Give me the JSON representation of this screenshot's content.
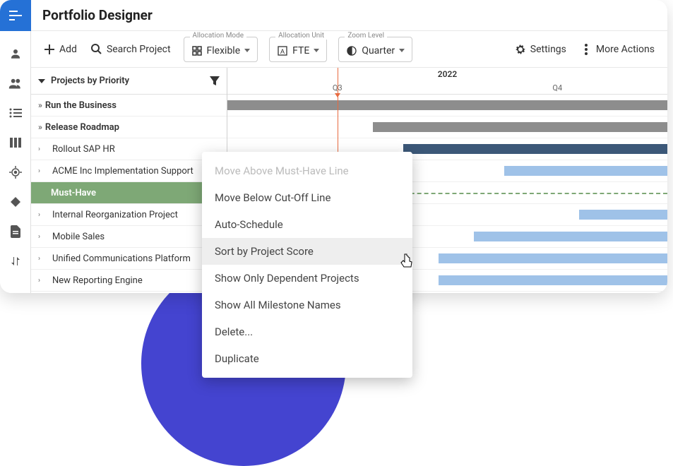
{
  "app_title": "Portfolio Designer",
  "toolbar": {
    "add": "Add",
    "search": "Search Project",
    "allocation_mode": {
      "label": "Allocation Mode",
      "value": "Flexible"
    },
    "allocation_unit": {
      "label": "Allocation Unit",
      "value": "FTE"
    },
    "zoom_level": {
      "label": "Zoom Level",
      "value": "Quarter"
    },
    "settings": "Settings",
    "more": "More Actions"
  },
  "sidebar": {
    "header": "Projects by Priority",
    "items": [
      {
        "label": "Run the Business",
        "type": "group"
      },
      {
        "label": "Release Roadmap",
        "type": "group"
      },
      {
        "label": "Rollout SAP HR",
        "type": "item"
      },
      {
        "label": "ACME Inc Implementation Support",
        "type": "item"
      },
      {
        "label": "Must-Have",
        "type": "musthave"
      },
      {
        "label": "Internal Reorganization Project",
        "type": "item"
      },
      {
        "label": "Mobile Sales",
        "type": "item"
      },
      {
        "label": "Unified Communications Platform",
        "type": "item"
      },
      {
        "label": "New Reporting Engine",
        "type": "item"
      }
    ]
  },
  "gantt": {
    "year": "2022",
    "quarters": [
      "Q3",
      "Q4"
    ]
  },
  "context_menu": {
    "items": [
      {
        "label": "Move Above Must-Have Line",
        "disabled": true
      },
      {
        "label": "Move Below Cut-Off Line",
        "disabled": false
      },
      {
        "label": "Auto-Schedule",
        "disabled": false
      },
      {
        "label": "Sort by Project Score",
        "disabled": false,
        "hover": true
      },
      {
        "label": "Show Only Dependent Projects",
        "disabled": false
      },
      {
        "label": "Show All Milestone Names",
        "disabled": false
      },
      {
        "label": "Delete...",
        "disabled": false
      },
      {
        "label": "Duplicate",
        "disabled": false
      }
    ]
  }
}
